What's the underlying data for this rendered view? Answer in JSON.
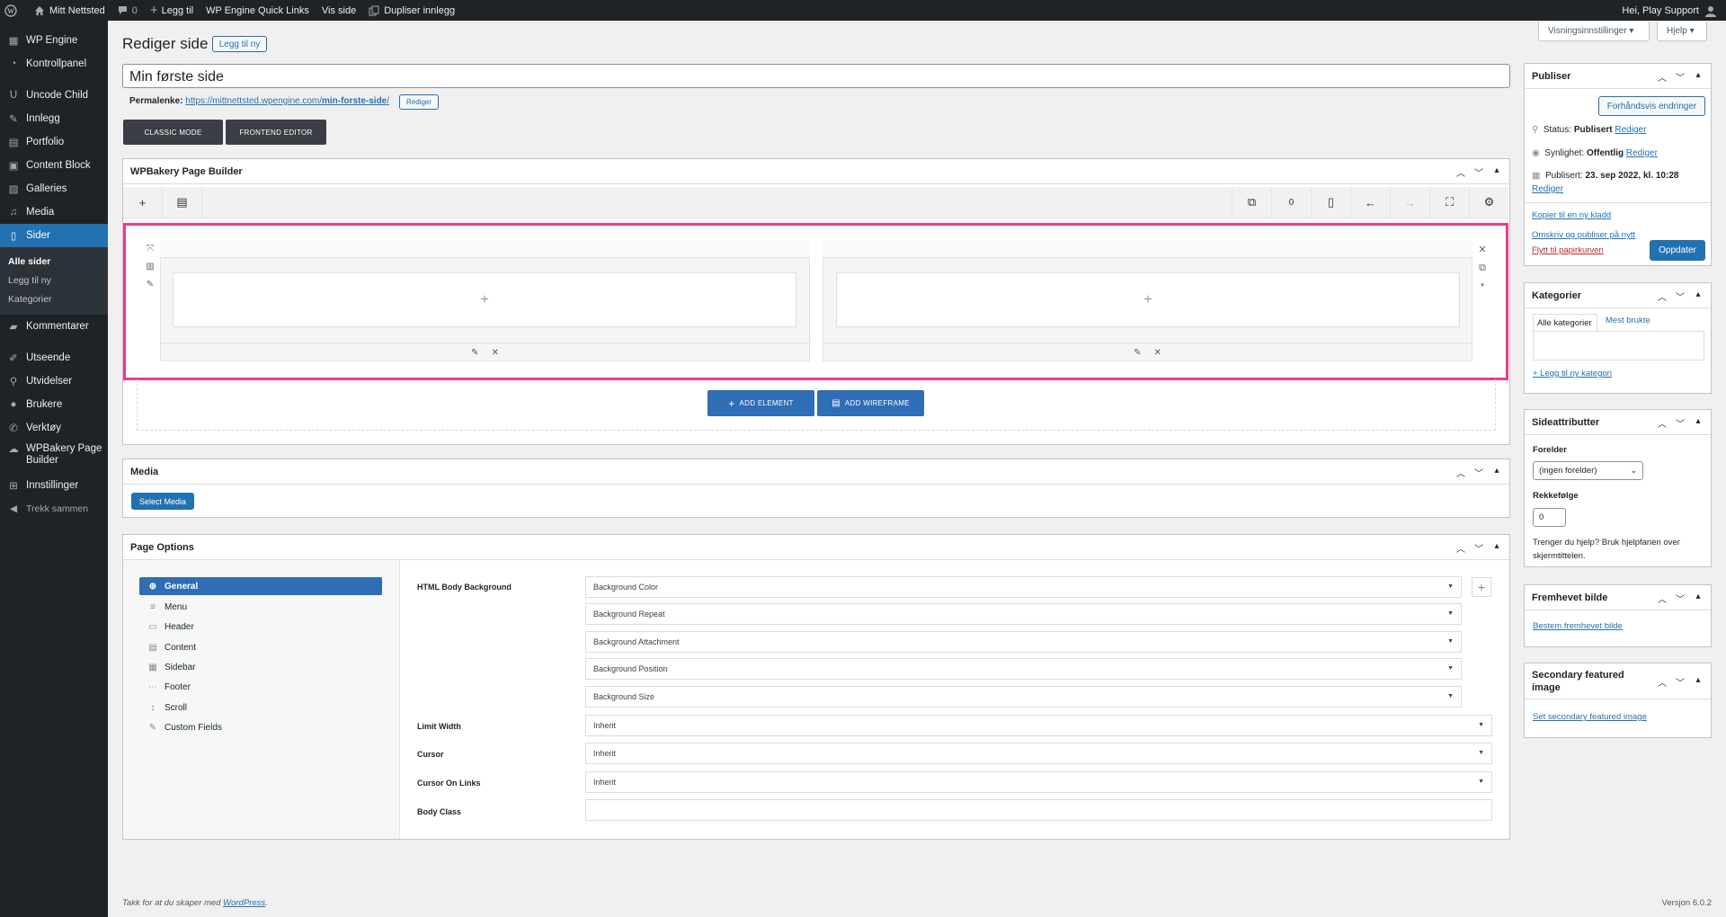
{
  "admin_bar": {
    "site_name": "Mitt Nettsted",
    "comments_count": "0",
    "new_label": "Legg til",
    "quick_links": "WP Engine Quick Links",
    "view_page": "Vis side",
    "duplicate": "Dupliser innlegg",
    "greeting": "Hei, Play Support"
  },
  "menu": {
    "items": [
      {
        "label": "WP Engine",
        "icon": "wpengine-icon"
      },
      {
        "label": "Kontrollpanel",
        "icon": "dashboard-icon"
      },
      {
        "label": "Uncode Child",
        "icon": "uncode-icon"
      },
      {
        "label": "Innlegg",
        "icon": "pin-icon"
      },
      {
        "label": "Portfolio",
        "icon": "portfolio-icon"
      },
      {
        "label": "Content Block",
        "icon": "block-icon"
      },
      {
        "label": "Galleries",
        "icon": "gallery-icon"
      },
      {
        "label": "Media",
        "icon": "media-icon"
      },
      {
        "label": "Sider",
        "icon": "page-icon"
      },
      {
        "label": "Kommentarer",
        "icon": "comment-icon"
      },
      {
        "label": "Utseende",
        "icon": "brush-icon"
      },
      {
        "label": "Utvidelser",
        "icon": "plugin-icon"
      },
      {
        "label": "Brukere",
        "icon": "users-icon"
      },
      {
        "label": "Verktøy",
        "icon": "wrench-icon"
      },
      {
        "label": "WPBakery Page Builder",
        "icon": "wpbakery-icon"
      },
      {
        "label": "Innstillinger",
        "icon": "settings-icon"
      }
    ],
    "submenu": [
      "Alle sider",
      "Legg til ny",
      "Kategorier"
    ],
    "collapse": "Trekk sammen"
  },
  "screen_options": "Visningsinnstillinger ▾",
  "help": "Hjelp ▾",
  "page": {
    "heading": "Rediger side",
    "add_new": "Legg til ny",
    "title_value": "Min første side",
    "permalink_label": "Permalenke:",
    "permalink_base": "https://mittnettsted.wpengine.com/",
    "permalink_slug": "min-forste-side",
    "permalink_end": "/",
    "permalink_edit": "Rediger",
    "classic_mode": "CLASSIC MODE",
    "frontend_editor": "FRONTEND EDITOR"
  },
  "wpbakery": {
    "title": "WPBakery Page Builder",
    "undo_count": "0",
    "add_element": "ADD ELEMENT",
    "add_wireframe": "ADD WIREFRAME",
    "highlight_color": "#e83e8c"
  },
  "media_box": {
    "title": "Media",
    "select_button": "Select Media"
  },
  "page_options": {
    "title": "Page Options",
    "nav": [
      "General",
      "Menu",
      "Header",
      "Content",
      "Sidebar",
      "Footer",
      "Scroll",
      "Custom Fields"
    ],
    "fields": {
      "html_body_background": "HTML Body Background",
      "bg_color": "Background Color",
      "bg_repeat": "Background Repeat",
      "bg_attachment": "Background Attachment",
      "bg_position": "Background Position",
      "bg_size": "Background Size",
      "limit_width": "Limit Width",
      "limit_width_value": "Inherit",
      "cursor": "Cursor",
      "cursor_value": "Inherit",
      "cursor_links": "Cursor On Links",
      "cursor_links_value": "Inherit",
      "body_class": "Body Class"
    }
  },
  "publish": {
    "title": "Publiser",
    "preview": "Forhåndsvis endringer",
    "status_label": "Status:",
    "status_value": "Publisert",
    "visibility_label": "Synlighet:",
    "visibility_value": "Offentlig",
    "published_label": "Publisert:",
    "published_value": "23. sep 2022, kl. 10:28",
    "edit": "Rediger",
    "copy_draft": "Kopier til en ny kladd",
    "rewrite": "Omskriv og publiser på nytt",
    "trash": "Flytt til papirkurven",
    "update": "Oppdater"
  },
  "categories": {
    "title": "Kategorier",
    "tab_all": "Alle kategorier",
    "tab_most": "Mest brukte",
    "add_new": "+ Legg til ny kategori"
  },
  "attributes": {
    "title": "Sideattributter",
    "parent_label": "Forelder",
    "parent_value": "(ingen forelder)",
    "order_label": "Rekkefølge",
    "order_value": "0",
    "help_text_1": "Trenger du hjelp? Bruk hjelpfanen over",
    "help_text_2": "skjermtittelen."
  },
  "featured": {
    "title": "Fremhevet bilde",
    "link": "Bestem fremhevet bilde"
  },
  "secondary_featured": {
    "title_1": "Secondary featured",
    "title_2": "image",
    "link": "Set secondary featured image"
  },
  "footer": {
    "thanks": "Takk for at du skaper med ",
    "wordpress": "WordPress",
    "period": ".",
    "version": "Versjon 6.0.2"
  }
}
